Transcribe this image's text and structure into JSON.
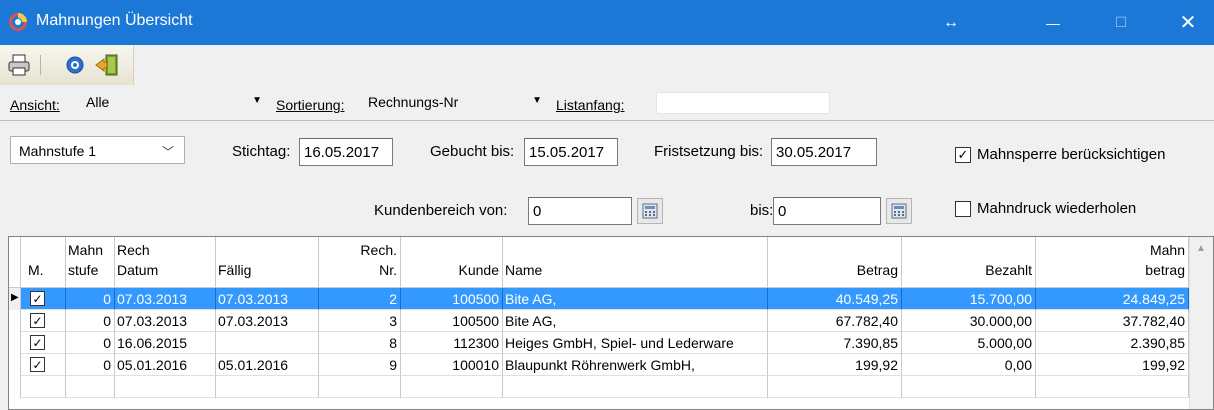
{
  "window": {
    "title": "Mahnungen Übersicht",
    "resize_glyph": "↔",
    "minimize_glyph": "—",
    "maximize_glyph": "☐",
    "close_glyph": "✕"
  },
  "toolbar": {
    "icons": [
      "printer-icon",
      "help-icon",
      "exit-door-icon"
    ]
  },
  "filter": {
    "ansicht_label": "Ansicht:",
    "ansicht_value": "Alle",
    "sortierung_label": "Sortierung:",
    "sortierung_value": "Rechnungs-Nr",
    "listanfang_label": "Listanfang:",
    "listanfang_value": ""
  },
  "params": {
    "mahnstufe_value": "Mahnstufe 1",
    "stichtag_label": "Stichtag:",
    "stichtag_value": "16.05.2017",
    "gebucht_label": "Gebucht bis:",
    "gebucht_value": "15.05.2017",
    "frist_label": "Fristsetzung bis:",
    "frist_value": "30.05.2017",
    "kunden_von_label": "Kundenbereich von:",
    "kunden_von_value": "0",
    "bis_label": "bis:",
    "bis_value": "0",
    "mahnsperre_label": "Mahnsperre berücksichtigen",
    "mahnsperre_checked": true,
    "mahndruck_label": "Mahndruck wiederholen",
    "mahndruck_checked": false
  },
  "grid": {
    "columns": [
      {
        "line1": "",
        "line2": "M."
      },
      {
        "line1": "Mahn",
        "line2": "stufe"
      },
      {
        "line1": "Rech",
        "line2": "Datum"
      },
      {
        "line1": "",
        "line2": "Fällig"
      },
      {
        "line1": "Rech.",
        "line2": "Nr."
      },
      {
        "line1": "",
        "line2": "Kunde"
      },
      {
        "line1": "",
        "line2": "Name"
      },
      {
        "line1": "",
        "line2": "Betrag"
      },
      {
        "line1": "",
        "line2": "Bezahlt"
      },
      {
        "line1": "Mahn",
        "line2": "betrag"
      }
    ],
    "rows": [
      {
        "checked": true,
        "selected": true,
        "stufe": "0",
        "datum": "07.03.2013",
        "faellig": "07.03.2013",
        "nr": "2",
        "kunde": "100500",
        "name": "Bite AG,",
        "betrag": "40.549,25",
        "bezahlt": "15.700,00",
        "mahnbetrag": "24.849,25"
      },
      {
        "checked": true,
        "selected": false,
        "stufe": "0",
        "datum": "07.03.2013",
        "faellig": "07.03.2013",
        "nr": "3",
        "kunde": "100500",
        "name": "Bite AG,",
        "betrag": "67.782,40",
        "bezahlt": "30.000,00",
        "mahnbetrag": "37.782,40"
      },
      {
        "checked": true,
        "selected": false,
        "stufe": "0",
        "datum": "16.06.2015",
        "faellig": "",
        "nr": "8",
        "kunde": "112300",
        "name": "Heiges GmbH, Spiel- und Lederware",
        "betrag": "7.390,85",
        "bezahlt": "5.000,00",
        "mahnbetrag": "2.390,85"
      },
      {
        "checked": true,
        "selected": false,
        "stufe": "0",
        "datum": "05.01.2016",
        "faellig": "05.01.2016",
        "nr": "9",
        "kunde": "100010",
        "name": "Blaupunkt Röhrenwerk GmbH,",
        "betrag": "199,92",
        "bezahlt": "0,00",
        "mahnbetrag": "199,92"
      }
    ]
  }
}
